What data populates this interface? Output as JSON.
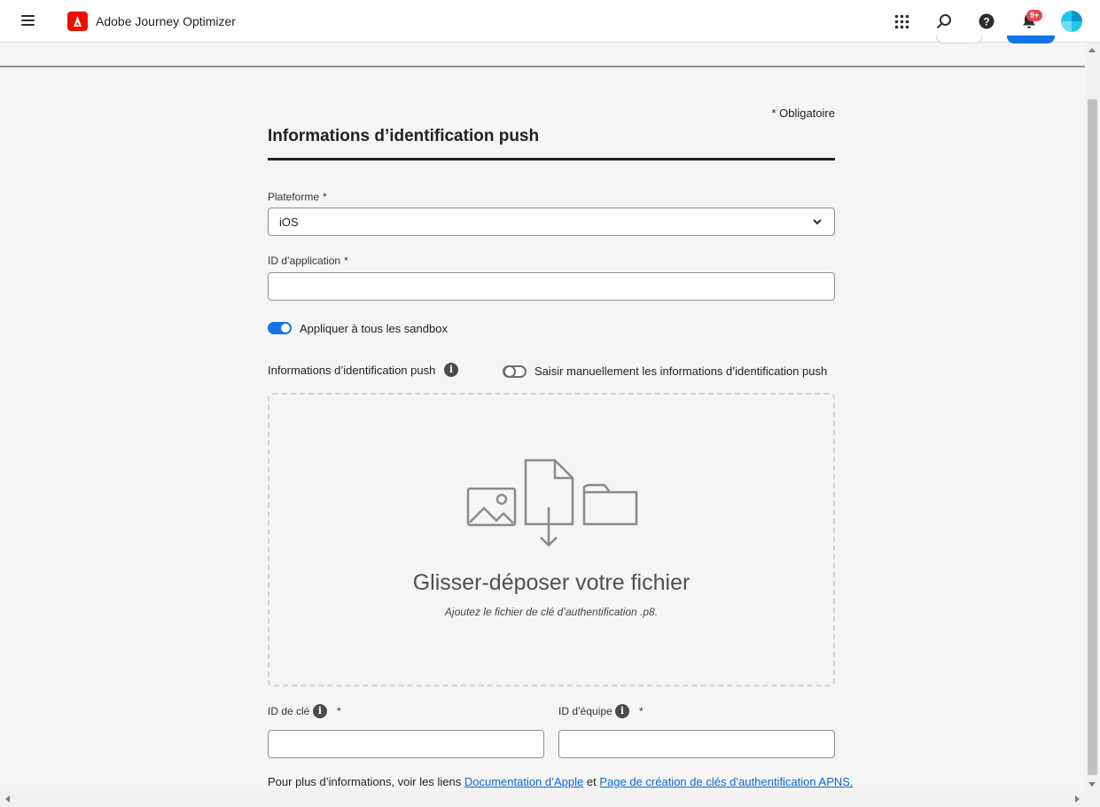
{
  "app": {
    "title": "Adobe Journey Optimizer",
    "notification_count": "9+",
    "icons": [
      "menu-icon",
      "adobe-logo-icon",
      "apps-grid-icon",
      "search-icon",
      "help-icon",
      "bell-icon",
      "avatar"
    ]
  },
  "form": {
    "required_note": "* Obligatoire",
    "title": "Informations d’identification push",
    "platform": {
      "label": "Plateforme",
      "required_mark": "*",
      "value": "iOS"
    },
    "app_id": {
      "label": "ID d’application",
      "required_mark": "*",
      "value": ""
    },
    "apply_all_sandboxes": {
      "label": "Appliquer à tous les sandbox",
      "on": true
    },
    "credentials": {
      "label": "Informations d’identification push",
      "manual_toggle_label": "Saisir manuellement les informations d’identification push",
      "manual_on": false
    },
    "dropzone": {
      "title": "Glisser-déposer votre fichier",
      "subtitle": "Ajoutez le fichier de clé d’authentification .p8."
    },
    "key_id": {
      "label": "ID de clé",
      "required_mark": "*",
      "value": ""
    },
    "team_id": {
      "label": "ID d’équipe",
      "required_mark": "*",
      "value": ""
    },
    "footer": {
      "prefix": "Pour plus d’informations, voir les liens",
      "link1": "Documentation d’Apple",
      "connector": "et",
      "link2": "Page de création de clés d’authentification APNS."
    }
  },
  "colors": {
    "accent": "#1473e6",
    "adobe_red": "#eb1000",
    "badge": "#e34850",
    "link": "#0d66d0",
    "avatar": "#1ec6ec"
  }
}
